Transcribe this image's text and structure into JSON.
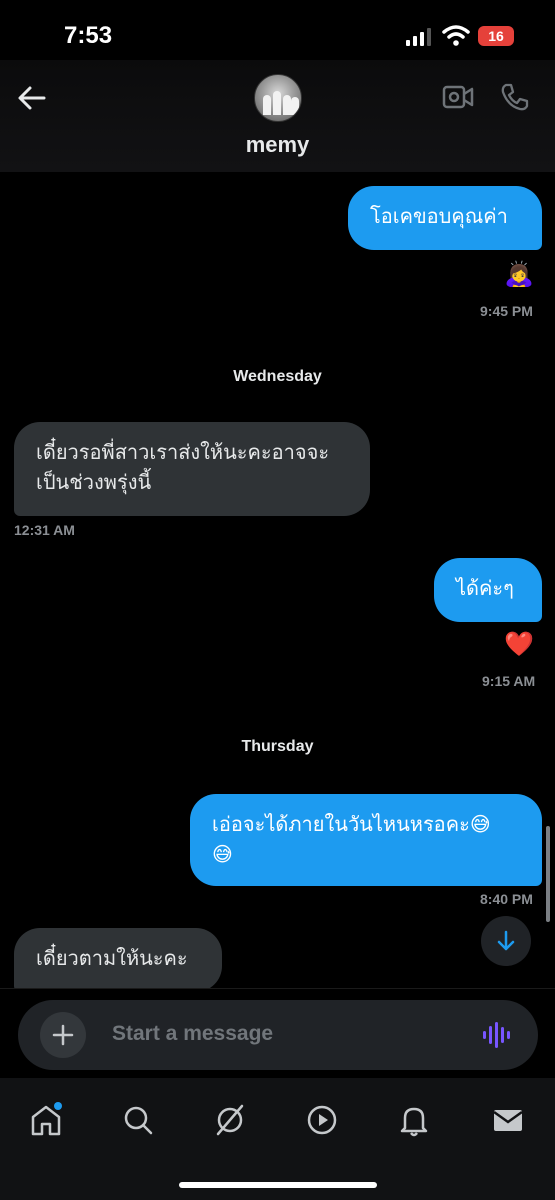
{
  "status_bar": {
    "time": "7:53",
    "battery": "16"
  },
  "header": {
    "contact_name": "memy"
  },
  "conversation": [
    {
      "text": "โอเคขอบคุณค่า",
      "reaction": "🙇‍♀️",
      "time": "9:45 PM"
    },
    {
      "day": "Wednesday"
    },
    {
      "text": "เดี๋ยวรอพี่สาวเราส่งให้นะคะอาจจะ\nเป็นช่วงพรุ่งนี้",
      "time": "12:31 AM"
    },
    {
      "text": "ได้ค่ะๆ",
      "reaction": "❤️",
      "time": "9:15 AM"
    },
    {
      "day": "Thursday"
    },
    {
      "text": "เอ่อจะได้ภายในวันไหนหรอคะ😅\n😅",
      "time": "8:40 PM"
    },
    {
      "text": "เดี๋ยวตามให้นะคะ"
    }
  ],
  "composer": {
    "placeholder": "Start a message"
  },
  "icons": {
    "back": "back-arrow-icon",
    "video": "video-call-icon",
    "phone": "phone-call-icon",
    "plus": "plus-icon",
    "voice": "voice-wave-icon",
    "scroll_down": "arrow-down-icon",
    "tabs": [
      "home-icon",
      "search-icon",
      "grok-icon",
      "video-play-icon",
      "bell-icon",
      "mail-icon"
    ]
  },
  "colors": {
    "accent": "#1d9bf0",
    "incoming_bubble": "#2f3336",
    "voice": "#7856ff",
    "notification_dot": "#1d9bf0"
  }
}
